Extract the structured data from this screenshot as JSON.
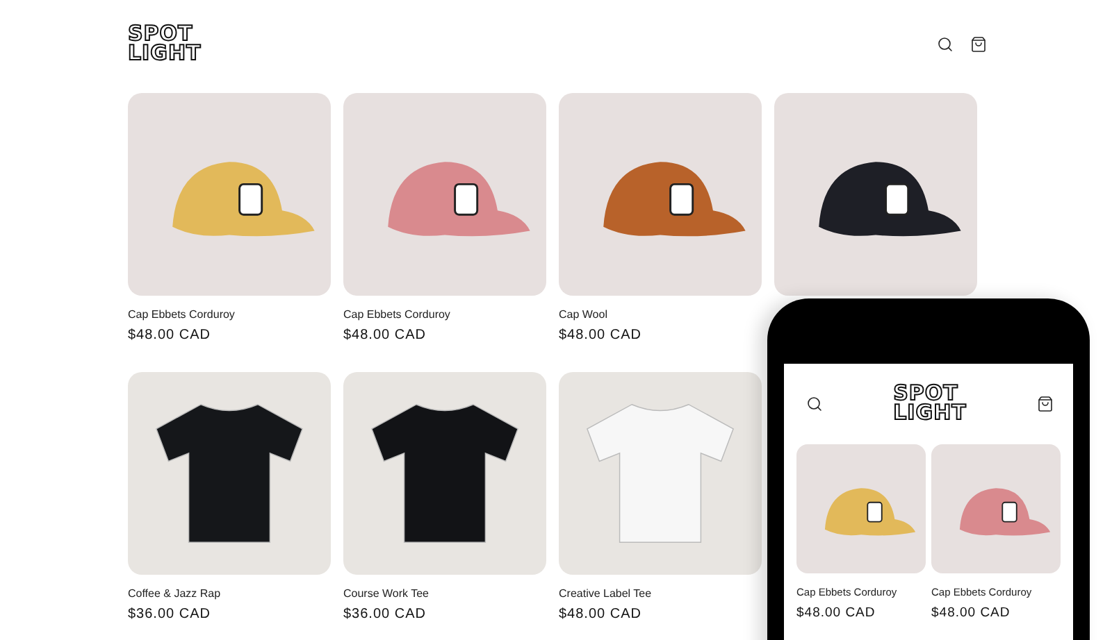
{
  "header": {
    "logo": [
      "SPOT",
      "LIGHT"
    ]
  },
  "products": [
    {
      "kind": "cap",
      "color": "#e2b95a",
      "name": "Cap Ebbets Corduroy",
      "price": "$48.00 CAD"
    },
    {
      "kind": "cap",
      "color": "#d98a8e",
      "name": "Cap Ebbets Corduroy",
      "price": "$48.00 CAD"
    },
    {
      "kind": "cap",
      "color": "#b8622a",
      "name": "Cap Wool",
      "price": "$48.00 CAD"
    },
    {
      "kind": "cap",
      "color": "#1e1f26"
    },
    {
      "kind": "tee",
      "color": "#15171a",
      "name": "Coffee & Jazz Rap",
      "price": "$36.00 CAD"
    },
    {
      "kind": "tee",
      "color": "#121316",
      "name": "Course Work Tee",
      "price": "$36.00 CAD"
    },
    {
      "kind": "tee",
      "color": "#f7f7f7",
      "name": "Creative Label Tee",
      "price": "$48.00 CAD"
    }
  ],
  "phone": {
    "logo": [
      "SPOT",
      "LIGHT"
    ],
    "products": [
      {
        "kind": "cap",
        "color": "#e2b95a",
        "name": "Cap Ebbets Corduroy",
        "price": "$48.00 CAD"
      },
      {
        "kind": "cap",
        "color": "#d98a8e",
        "name": "Cap Ebbets Corduroy",
        "price": "$48.00 CAD"
      }
    ]
  }
}
